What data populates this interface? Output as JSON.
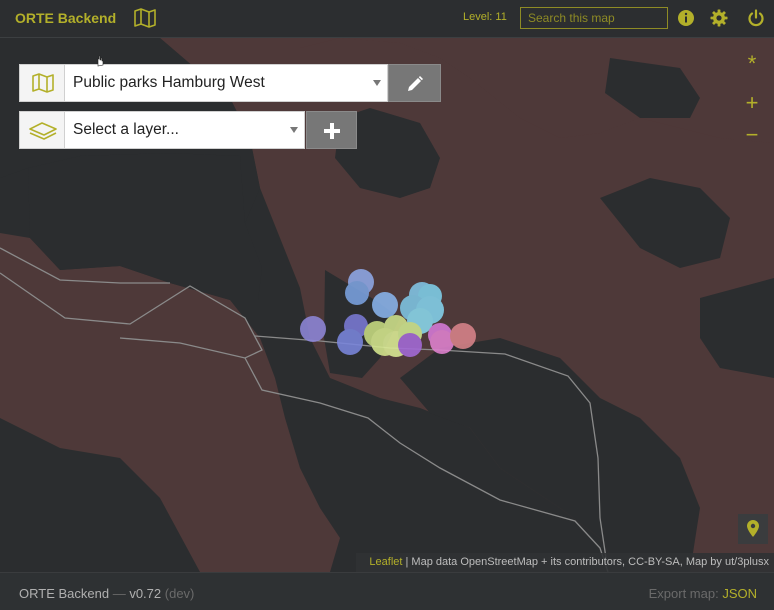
{
  "header": {
    "brand": "ORTE Backend",
    "brand_icon": "map-icon",
    "level_label": "Level: 11",
    "search_placeholder": "Search this map",
    "icons": [
      "info-icon",
      "gear-icon",
      "power-icon"
    ]
  },
  "map_controls": {
    "map_select": {
      "icon": "map-icon",
      "value": "Public parks Hamburg West",
      "edit_icon": "pencil-icon"
    },
    "layer_select": {
      "icon": "layers-icon",
      "placeholder": "Select a layer...",
      "add_icon": "plus-icon"
    },
    "buttons": {
      "star": "*",
      "zoom_in": "+",
      "zoom_out": "−"
    },
    "locate_icon": "map-marker-icon"
  },
  "attribution": {
    "link": "Leaflet",
    "text": " | Map data OpenStreetMap + its contributors, CC-BY-SA, Map by ut/3plusx"
  },
  "footer": {
    "app": "ORTE Backend",
    "separator": " — ",
    "version": "v0.72",
    "channel": "(dev)",
    "export_label": "Export map:",
    "export_link": "JSON"
  },
  "colors": {
    "accent": "#b3b02a",
    "land": "#4f3a3a",
    "water": "#2b2d2f"
  }
}
